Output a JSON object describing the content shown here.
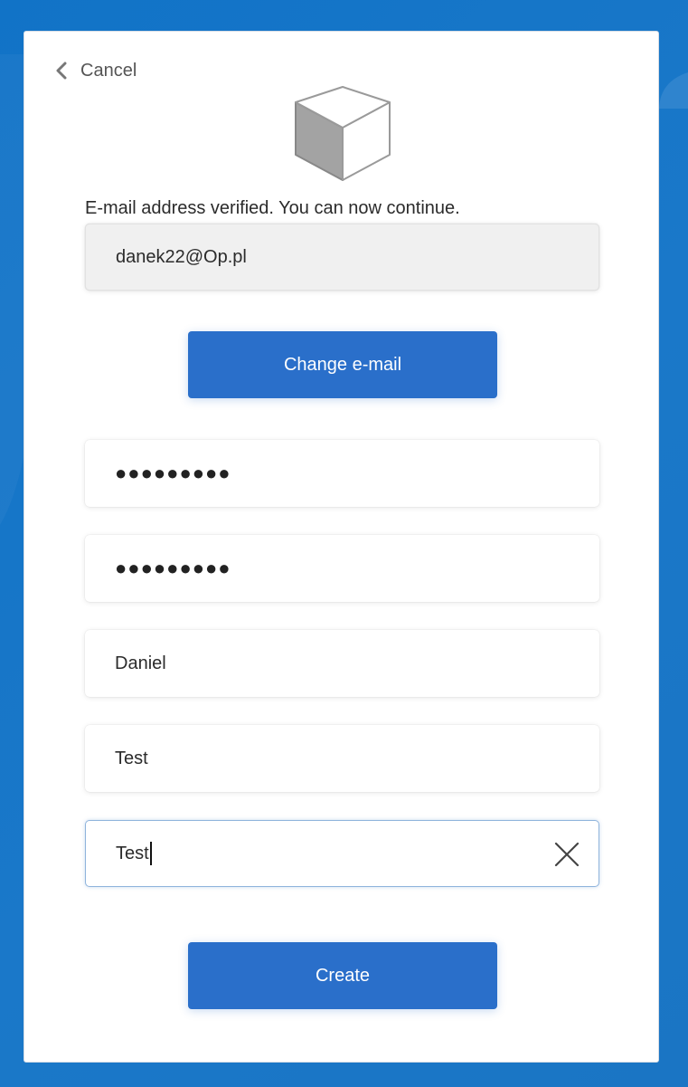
{
  "nav": {
    "cancel_label": "Cancel"
  },
  "header": {
    "logo_icon": "cube-icon",
    "status_text": "E-mail address verified. You can now continue."
  },
  "form": {
    "email_value": "danek22@Op.pl",
    "change_email_label": "Change e-mail",
    "password_value": "●●●●●●●●●",
    "confirm_password_value": "●●●●●●●●●",
    "first_name_value": "Daniel",
    "last_name_value": "Test",
    "display_name_value": "Test",
    "create_label": "Create"
  },
  "colors": {
    "background": "#1173c7",
    "button": "#2a6fca",
    "card": "#ffffff",
    "readonly_field": "#f0f0f0"
  }
}
